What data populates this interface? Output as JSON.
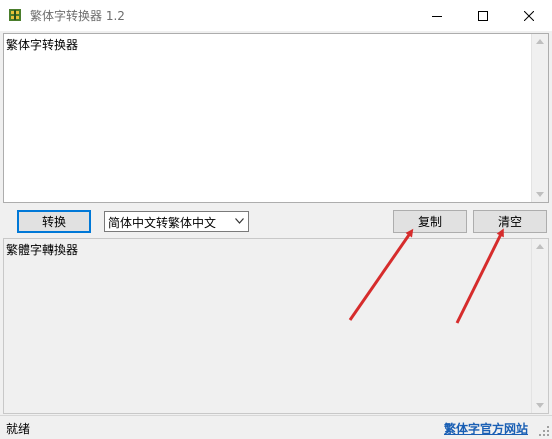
{
  "window": {
    "title": "繁体字转换器 1.2",
    "controls": [
      "minimize-icon",
      "maximize-icon",
      "close-icon"
    ]
  },
  "input_pane": {
    "text": "繁体字转换器"
  },
  "toolbar": {
    "convert_label": "转换",
    "mode_selected": "简体中文转繁体中文",
    "copy_label": "复制",
    "clear_label": "清空"
  },
  "output_pane": {
    "text": "繁體字轉換器"
  },
  "statusbar": {
    "status": "就绪",
    "link": "繁体字官方网站"
  },
  "colors": {
    "accent": "#0078d7",
    "annotation_arrow": "#d62c2c",
    "link": "#1a5fb4"
  }
}
